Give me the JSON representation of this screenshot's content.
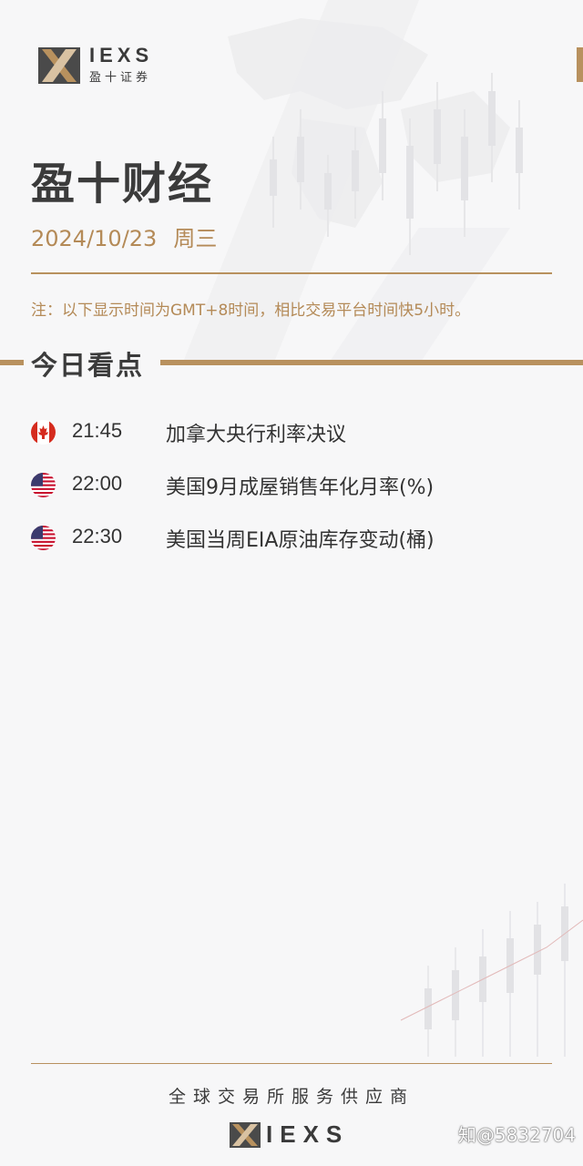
{
  "brand": {
    "name_en": "IEXS",
    "name_cn": "盈十证券"
  },
  "header": {
    "title": "盈十财经",
    "date": "2024/10/23",
    "weekday": "周三",
    "note": "注：以下显示时间为GMT+8时间，相比交易平台时间快5小时。"
  },
  "section": {
    "title": "今日看点"
  },
  "events": [
    {
      "flag": "canada-flag-icon",
      "time": "21:45",
      "title": "加拿大央行利率决议"
    },
    {
      "flag": "us-flag-icon",
      "time": "22:00",
      "title": "美国9月成屋销售年化月率(%)"
    },
    {
      "flag": "us-flag-icon",
      "time": "22:30",
      "title": "美国当周EIA原油库存变动(桶)"
    }
  ],
  "footer": {
    "tagline": "全球交易所服务供应商",
    "brand_en": "IEXS"
  },
  "watermark": "知@5832704",
  "colors": {
    "accent": "#b8915e",
    "text": "#3b3b3b",
    "background": "#f7f7f8"
  }
}
